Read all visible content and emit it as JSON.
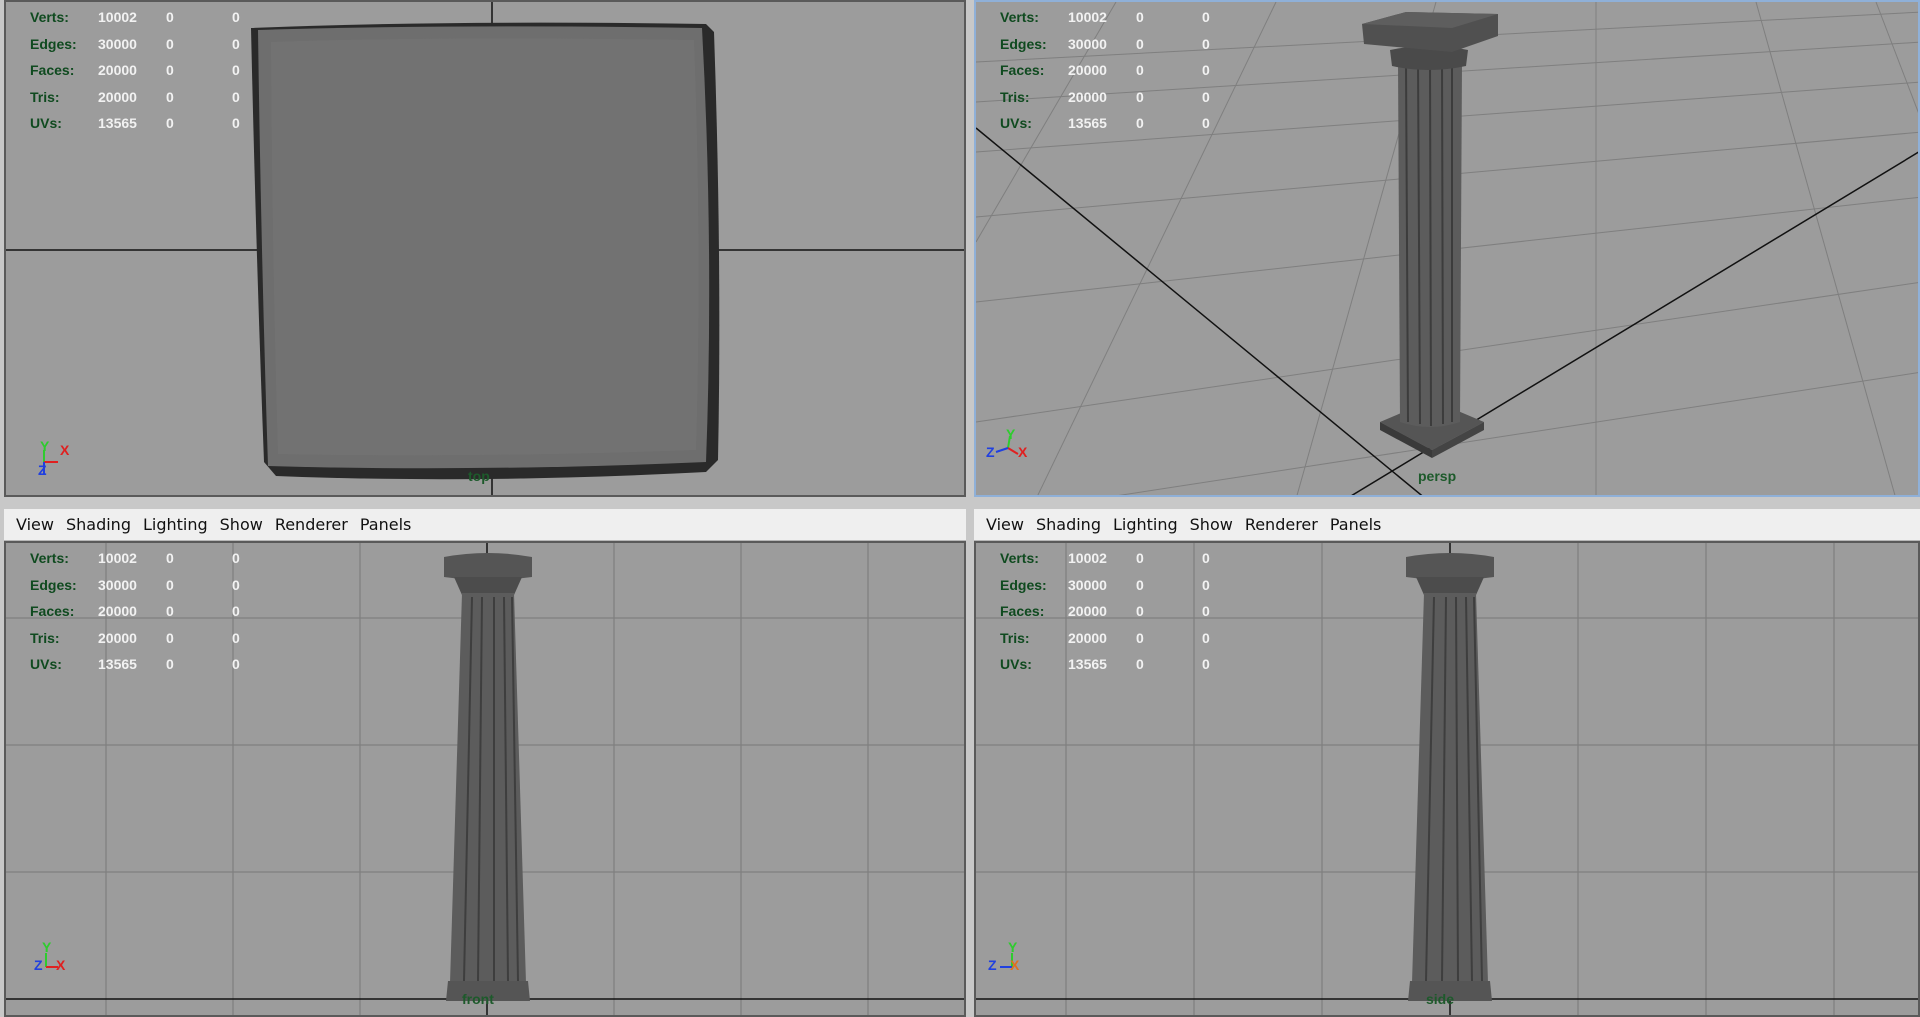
{
  "menu": [
    "View",
    "Shading",
    "Lighting",
    "Show",
    "Renderer",
    "Panels"
  ],
  "hud_stats": [
    {
      "label": "Verts:",
      "v1": "10002",
      "v2": "0",
      "v3": "0"
    },
    {
      "label": "Edges:",
      "v1": "30000",
      "v2": "0",
      "v3": "0"
    },
    {
      "label": "Faces:",
      "v1": "20000",
      "v2": "0",
      "v3": "0"
    },
    {
      "label": "Tris:",
      "v1": "20000",
      "v2": "0",
      "v3": "0"
    },
    {
      "label": "UVs:",
      "v1": "13565",
      "v2": "0",
      "v3": "0"
    }
  ],
  "viewports": {
    "top": {
      "camera": "top",
      "axes": [
        "Y",
        "X",
        "Z"
      ]
    },
    "persp": {
      "camera": "persp",
      "axes": [
        "Y",
        "Z",
        "X"
      ]
    },
    "front": {
      "camera": "front",
      "axes": [
        "Y",
        "Z",
        "X"
      ]
    },
    "side": {
      "camera": "side",
      "axes": [
        "Y",
        "Z",
        "X"
      ]
    }
  },
  "colors": {
    "viewport_bg": "#9c9c9c",
    "grid": "#7f7f7f",
    "active_border": "#8fb0d8",
    "axis_y": "#2ecc2e",
    "axis_x": "#e02020",
    "axis_z": "#2040e0"
  }
}
